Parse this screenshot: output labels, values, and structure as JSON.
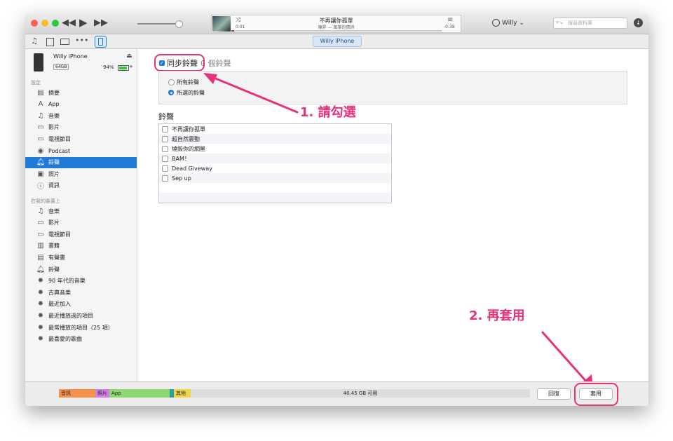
{
  "player": {
    "song_title": "不再讓你孤單",
    "song_artist": "陳昇 — 風箏的情詩",
    "time_elapsed": "0:01",
    "time_remaining": "-0:38"
  },
  "account": {
    "user_label": "Willy ⌄"
  },
  "search": {
    "placeholder": "搜尋資料庫"
  },
  "device_tab": {
    "label": "Willy  iPhone"
  },
  "device": {
    "name": "Willy  iPhone",
    "capacity": "64GB",
    "battery": "94%",
    "battery_level": 0.94
  },
  "sidebar": {
    "settings_header": "設定",
    "settings_items": [
      {
        "label": "摘要",
        "icon": "summary-icon"
      },
      {
        "label": "App",
        "icon": "app-icon"
      },
      {
        "label": "音樂",
        "icon": "music-icon"
      },
      {
        "label": "影片",
        "icon": "film-icon"
      },
      {
        "label": "電視節目",
        "icon": "tv-icon"
      },
      {
        "label": "Podcast",
        "icon": "podcast-icon"
      },
      {
        "label": "鈴聲",
        "icon": "bell-icon"
      },
      {
        "label": "照片",
        "icon": "camera-icon"
      },
      {
        "label": "資訊",
        "icon": "info-icon"
      }
    ],
    "device_header": "在我的裝置上",
    "device_items": [
      {
        "label": "音樂",
        "icon": "music-icon"
      },
      {
        "label": "影片",
        "icon": "film-icon"
      },
      {
        "label": "電視節目",
        "icon": "tv-icon"
      },
      {
        "label": "書籍",
        "icon": "book-icon"
      },
      {
        "label": "有聲書",
        "icon": "audiobook-icon"
      },
      {
        "label": "鈴聲",
        "icon": "bell-icon"
      },
      {
        "label": "90 年代的音樂",
        "icon": "gear-icon"
      },
      {
        "label": "古典音樂",
        "icon": "gear-icon"
      },
      {
        "label": "最近加入",
        "icon": "gear-icon"
      },
      {
        "label": "最近播放過的項目",
        "icon": "gear-icon"
      },
      {
        "label": "最常播放的項目（25 項）",
        "icon": "gear-icon"
      },
      {
        "label": "最喜愛的歌曲",
        "icon": "gear-icon"
      }
    ]
  },
  "main": {
    "sync_label": "同步鈴聲",
    "sync_count": "0 個鈴聲",
    "option_all": "所有鈴聲",
    "option_selected": "所選的鈴聲",
    "list_title": "鈴聲",
    "ringtones": [
      "不再讓你孤單",
      "超自然震動",
      "燒毀你的網屋",
      "BAM！",
      "Dead Giveway",
      "Sep up"
    ]
  },
  "annotations": {
    "step1": "1. 請勾選",
    "step2": "2. 再套用"
  },
  "capacity_bar": {
    "segments": [
      {
        "label": "音訊",
        "color": "#f4914b"
      },
      {
        "label": "照片",
        "color": "#d37de8"
      },
      {
        "label": "App",
        "color": "#8ed873"
      },
      {
        "label": "",
        "color": "#29a0a0"
      },
      {
        "label": "其他",
        "color": "#f0d44a"
      }
    ],
    "free_label": "40.45 GB 可用"
  },
  "buttons": {
    "revert": "回復",
    "apply": "套用"
  },
  "colors": {
    "accent": "#1f7ad8",
    "annotation": "#e8317a"
  }
}
